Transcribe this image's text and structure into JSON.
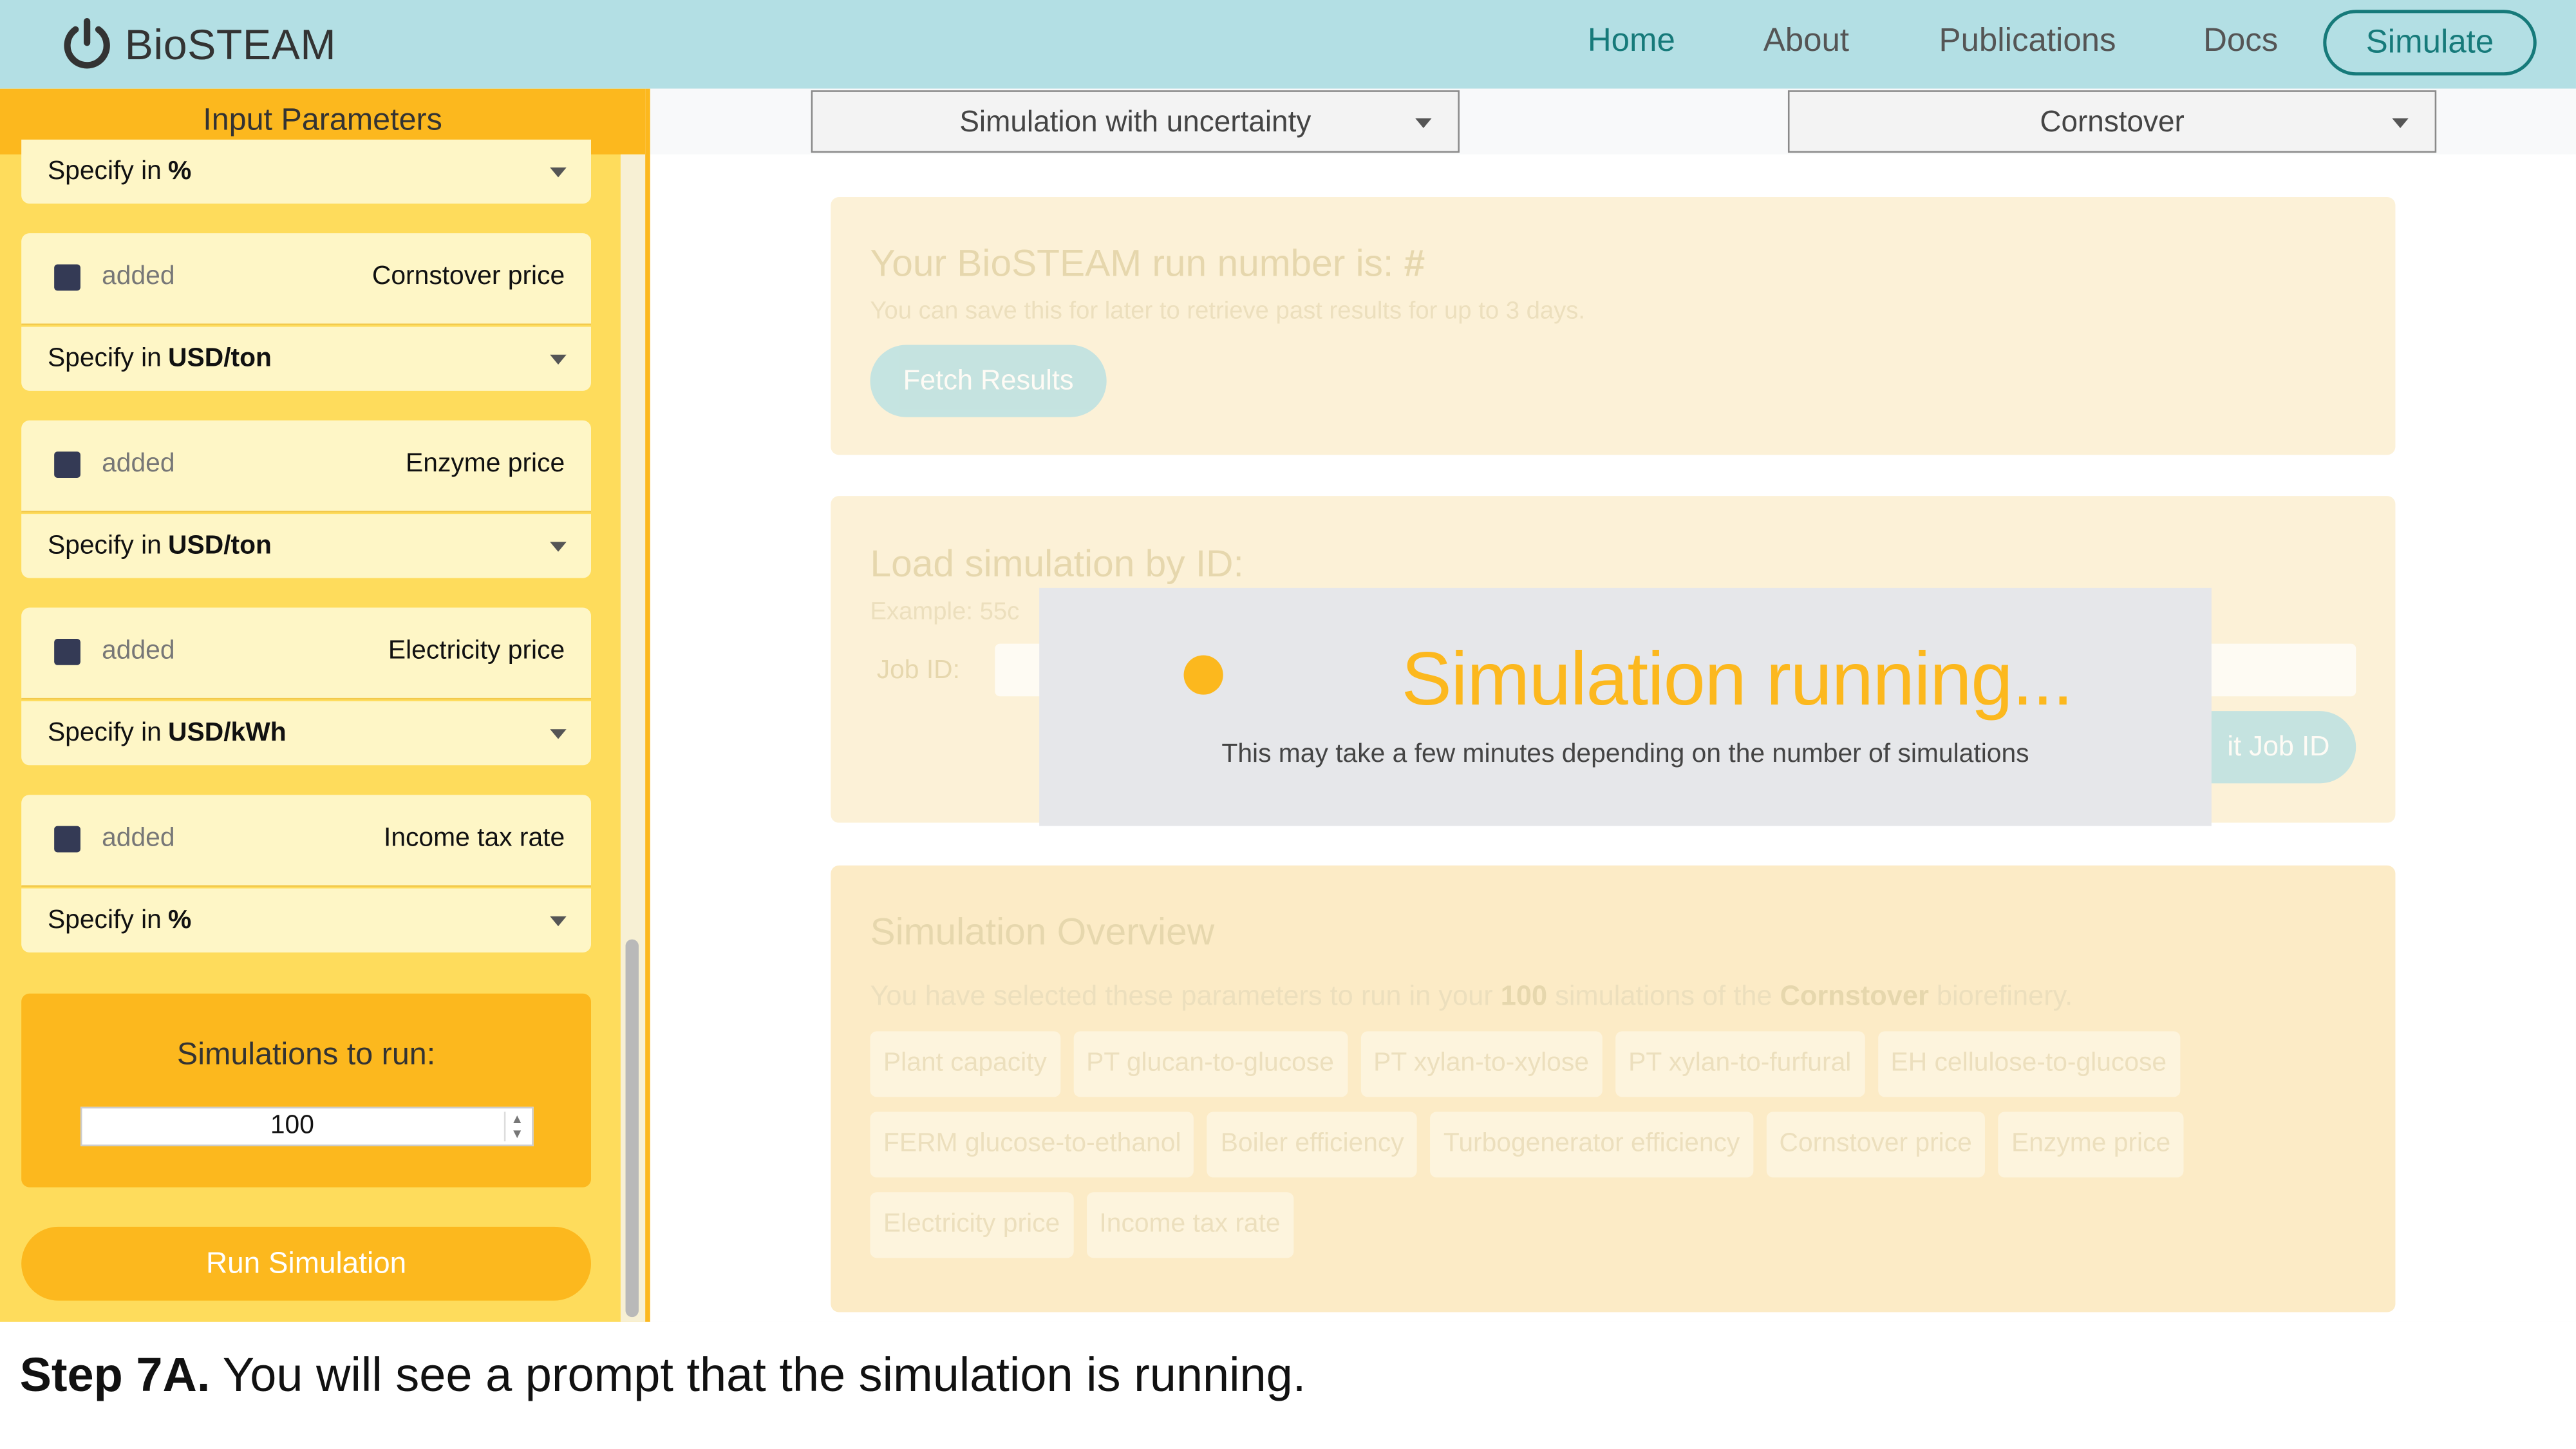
{
  "app": {
    "name": "BioSTEAM",
    "logo_icon": "power-icon"
  },
  "nav": {
    "items": [
      {
        "label": "Home",
        "active": true
      },
      {
        "label": "About",
        "active": false
      },
      {
        "label": "Publications",
        "active": false
      },
      {
        "label": "Docs",
        "active": false
      }
    ],
    "cta_label": "Simulate"
  },
  "sidebar": {
    "header": "Input Parameters",
    "top_select": {
      "prefix": "Specify in",
      "unit": "%"
    },
    "params": [
      {
        "status": "added",
        "name": "Cornstover price",
        "prefix": "Specify in",
        "unit": "USD/ton"
      },
      {
        "status": "added",
        "name": "Enzyme price",
        "prefix": "Specify in",
        "unit": "USD/ton"
      },
      {
        "status": "added",
        "name": "Electricity price",
        "prefix": "Specify in",
        "unit": "USD/kWh"
      },
      {
        "status": "added",
        "name": "Income tax rate",
        "prefix": "Specify in",
        "unit": "%"
      }
    ],
    "simulations_label": "Simulations to run:",
    "simulations_value": "100",
    "run_button": "Run Simulation"
  },
  "toolbar": {
    "mode_select": "Simulation with uncertainty",
    "feedstock_select": "Cornstover"
  },
  "run_card": {
    "title": "Your BioSTEAM run number is:",
    "run_number": "#",
    "subtitle": "You can save this for later to retrieve past results for up to 3 days.",
    "fetch_button": "Fetch Results"
  },
  "load_card": {
    "title": "Load simulation by ID:",
    "example": "Example: 55c",
    "job_label": "Job ID:",
    "submit_button": "it Job ID"
  },
  "overview": {
    "title": "Simulation Overview",
    "text_prefix": "You have selected these parameters to run in your",
    "sim_count": "100",
    "text_middle": "simulations of the",
    "feedstock": "Cornstover",
    "text_suffix": "biorefinery.",
    "chips": [
      "Plant capacity",
      "PT glucan-to-glucose",
      "PT xylan-to-xylose",
      "PT xylan-to-furfural",
      "EH cellulose-to-glucose",
      "FERM glucose-to-ethanol",
      "Boiler efficiency",
      "Turbogenerator efficiency",
      "Cornstover price",
      "Enzyme price",
      "Electricity price",
      "Income tax rate"
    ]
  },
  "overlay": {
    "title": "Simulation running...",
    "subtitle": "This may take a few minutes depending on the number of simulations"
  },
  "caption": {
    "step": "Step 7A.",
    "text": "You will see a prompt that the simulation is running."
  },
  "colors": {
    "navbar": "#b3dfe4",
    "accent_teal": "#167a7a",
    "accent_yellow": "#fcb81e",
    "sidebar": "#fedc5c"
  }
}
